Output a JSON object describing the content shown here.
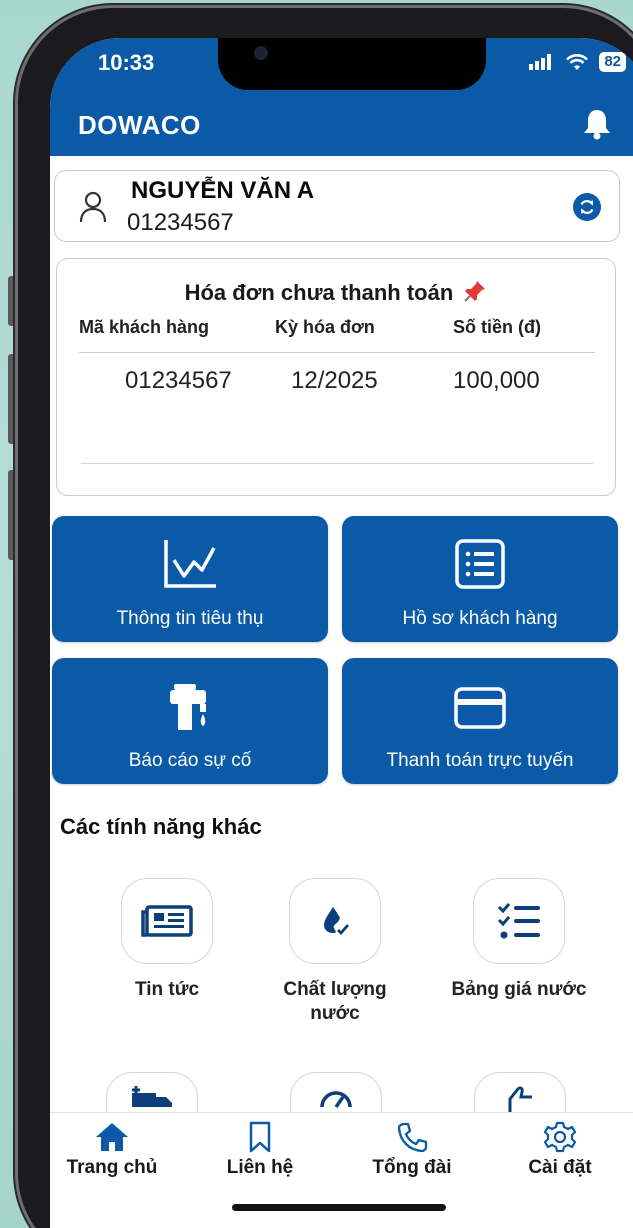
{
  "status_bar": {
    "time": "10:33",
    "battery": "82"
  },
  "header": {
    "app_title": "DOWACO"
  },
  "user": {
    "name": "NGUYỄN VĂN A",
    "code": "01234567"
  },
  "bill": {
    "title": "Hóa đơn chưa thanh toán",
    "columns": [
      "Mã khách hàng",
      "Kỳ hóa đơn",
      "Số tiền (đ)"
    ],
    "rows": [
      {
        "customer_code": "01234567",
        "period": "12/2025",
        "amount": "100,000"
      }
    ]
  },
  "tiles": [
    {
      "label": "Thông tin tiêu thụ",
      "icon": "chart-line-icon"
    },
    {
      "label": "Hồ sơ khách hàng",
      "icon": "document-list-icon"
    },
    {
      "label": "Báo cáo sự cố",
      "icon": "water-tap-icon"
    },
    {
      "label": "Thanh toán trực tuyến",
      "icon": "credit-card-icon"
    }
  ],
  "features": {
    "title": "Các tính năng khác",
    "items": [
      {
        "label": "Tin tức",
        "icon": "newspaper-icon"
      },
      {
        "label": "Chất lượng nước",
        "icon": "water-drop-check-icon"
      },
      {
        "label": "Bảng giá nước",
        "icon": "checklist-icon"
      }
    ]
  },
  "bottom_nav": [
    {
      "label": "Trang chủ",
      "icon": "home-icon"
    },
    {
      "label": "Liên hệ",
      "icon": "bookmark-icon"
    },
    {
      "label": "Tổng đài",
      "icon": "phone-icon"
    },
    {
      "label": "Cài đặt",
      "icon": "gear-icon"
    }
  ],
  "colors": {
    "primary": "#0b5aa8",
    "background": "#ffffff"
  }
}
